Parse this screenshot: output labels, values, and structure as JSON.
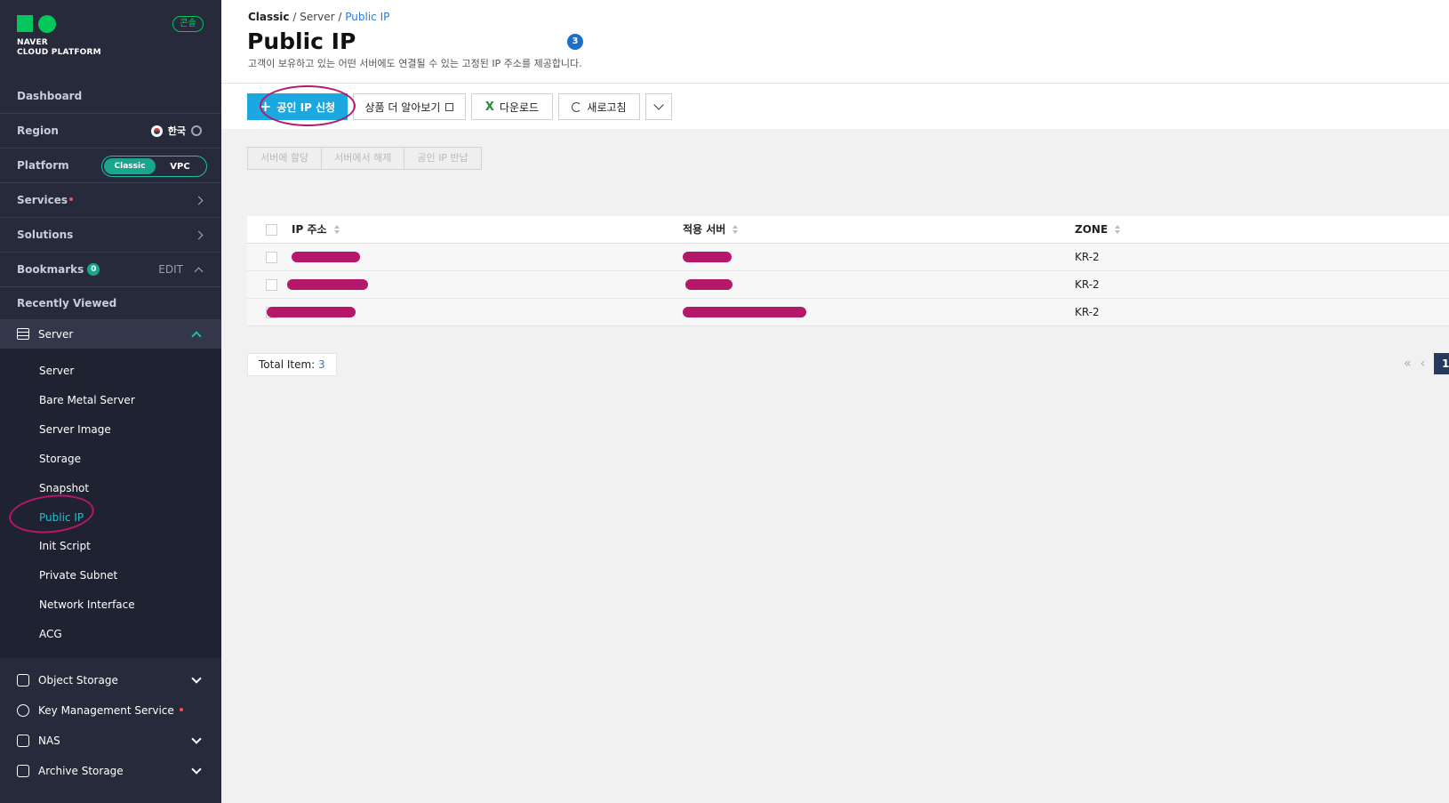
{
  "sidebar": {
    "logo": {
      "line1": "NAVER",
      "line2": "CLOUD PLATFORM"
    },
    "console_badge": "콘솔",
    "dashboard": "Dashboard",
    "region": {
      "label": "Region",
      "value": "한국"
    },
    "platform": {
      "label": "Platform",
      "options": [
        "Classic",
        "VPC"
      ],
      "selected": "Classic"
    },
    "services": "Services",
    "solutions": "Solutions",
    "bookmarks": {
      "label": "Bookmarks",
      "count": "0",
      "edit": "EDIT"
    },
    "recently_viewed": "Recently Viewed",
    "server_section": {
      "label": "Server",
      "items": [
        "Server",
        "Bare Metal Server",
        "Server Image",
        "Storage",
        "Snapshot",
        "Public IP",
        "Init Script",
        "Private Subnet",
        "Network Interface",
        "ACG"
      ],
      "active": "Public IP"
    },
    "categories": [
      {
        "label": "Object Storage",
        "icon": "object-storage-icon",
        "expandable": true,
        "new": false
      },
      {
        "label": "Key Management Service",
        "icon": "key-management-icon",
        "expandable": false,
        "new": true
      },
      {
        "label": "NAS",
        "icon": "nas-icon",
        "expandable": true,
        "new": false
      },
      {
        "label": "Archive Storage",
        "icon": "archive-storage-icon",
        "expandable": true,
        "new": false
      }
    ]
  },
  "header": {
    "breadcrumb": [
      "Classic",
      "Server",
      "Public IP"
    ],
    "title": "Public IP",
    "count": "3",
    "description": "고객이 보유하고 있는 어떤 서버에도 연결될 수 있는 고정된 IP 주소를 제공합니다."
  },
  "toolbar": {
    "request_label": "공인 IP 신청",
    "learn_more_label": "상품 더 알아보기",
    "download_label": "다운로드",
    "refresh_label": "새로고침"
  },
  "actions": {
    "assign": "서버에 할당",
    "release": "서버에서 해제",
    "return": "공인 IP 반납"
  },
  "table": {
    "columns": [
      "IP 주소",
      "적용 서버",
      "ZONE"
    ],
    "rows": [
      {
        "ip": "",
        "server": "",
        "zone": "KR-2"
      },
      {
        "ip": "",
        "server": "",
        "zone": "KR-2"
      },
      {
        "ip": "",
        "server": "",
        "zone": "KR-2"
      }
    ]
  },
  "footer": {
    "total_label": "Total Item:",
    "total_value": "3",
    "current_page": "1"
  },
  "colors": {
    "sidebar_bg": "#262a3a",
    "primary_button": "#1ba8e0",
    "accent_green": "#03c75a",
    "active_link": "#1dc1d9",
    "annotation": "#b5176a",
    "pager_active": "#25385e"
  }
}
